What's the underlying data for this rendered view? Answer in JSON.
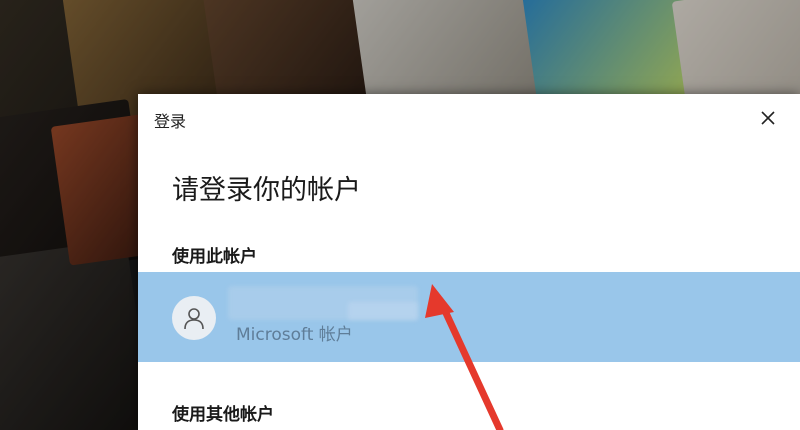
{
  "dialog": {
    "title": "登录",
    "heading": "请登录你的帐户",
    "section_this_account": "使用此帐户",
    "account": {
      "type_label": "Microsoft 帐户"
    },
    "section_other_account": "使用其他帐户"
  },
  "colors": {
    "selected_row": "#99c6ea",
    "arrow": "#e5392c"
  },
  "icons": {
    "close": "close-icon",
    "avatar": "person-icon"
  }
}
